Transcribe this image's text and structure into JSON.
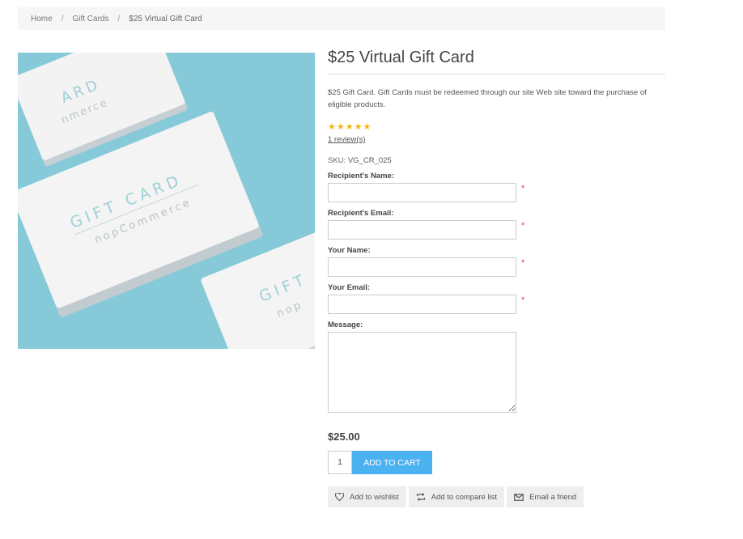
{
  "breadcrumb": {
    "home": "Home",
    "category": "Gift Cards",
    "current": "$25 Virtual Gift Card",
    "separator": "/"
  },
  "product": {
    "image_card_text": "GIFT CARD",
    "image_card_subtext": "nopCommerce",
    "image_corner_text": "ARD",
    "image_corner_subtext": "nmerce",
    "image_bottom_text": "GIFT",
    "image_bottom_subtext": "nop",
    "title": "$25 Virtual Gift Card",
    "description": "$25 Gift Card. Gift Cards must be redeemed through our site Web site toward the purchase of eligible products.",
    "rating_stars": 5,
    "reviews_link": "1 review(s)",
    "sku_label": "SKU:",
    "sku_value": "VG_CR_025",
    "price": "$25.00"
  },
  "form": {
    "recipient_name_label": "Recipient's Name:",
    "recipient_email_label": "Recipient's Email:",
    "your_name_label": "Your Name:",
    "your_email_label": "Your Email:",
    "message_label": "Message:",
    "required_marker": "*"
  },
  "cart": {
    "quantity": "1",
    "add_to_cart_label": "ADD TO CART"
  },
  "actions": {
    "wishlist_label": "Add to wishlist",
    "compare_label": "Add to compare list",
    "email_friend_label": "Email a friend"
  },
  "colors": {
    "accent": "#4ab2f1",
    "star": "#f5b50a",
    "required": "#e4444c",
    "image_background": "#86c9d9"
  }
}
